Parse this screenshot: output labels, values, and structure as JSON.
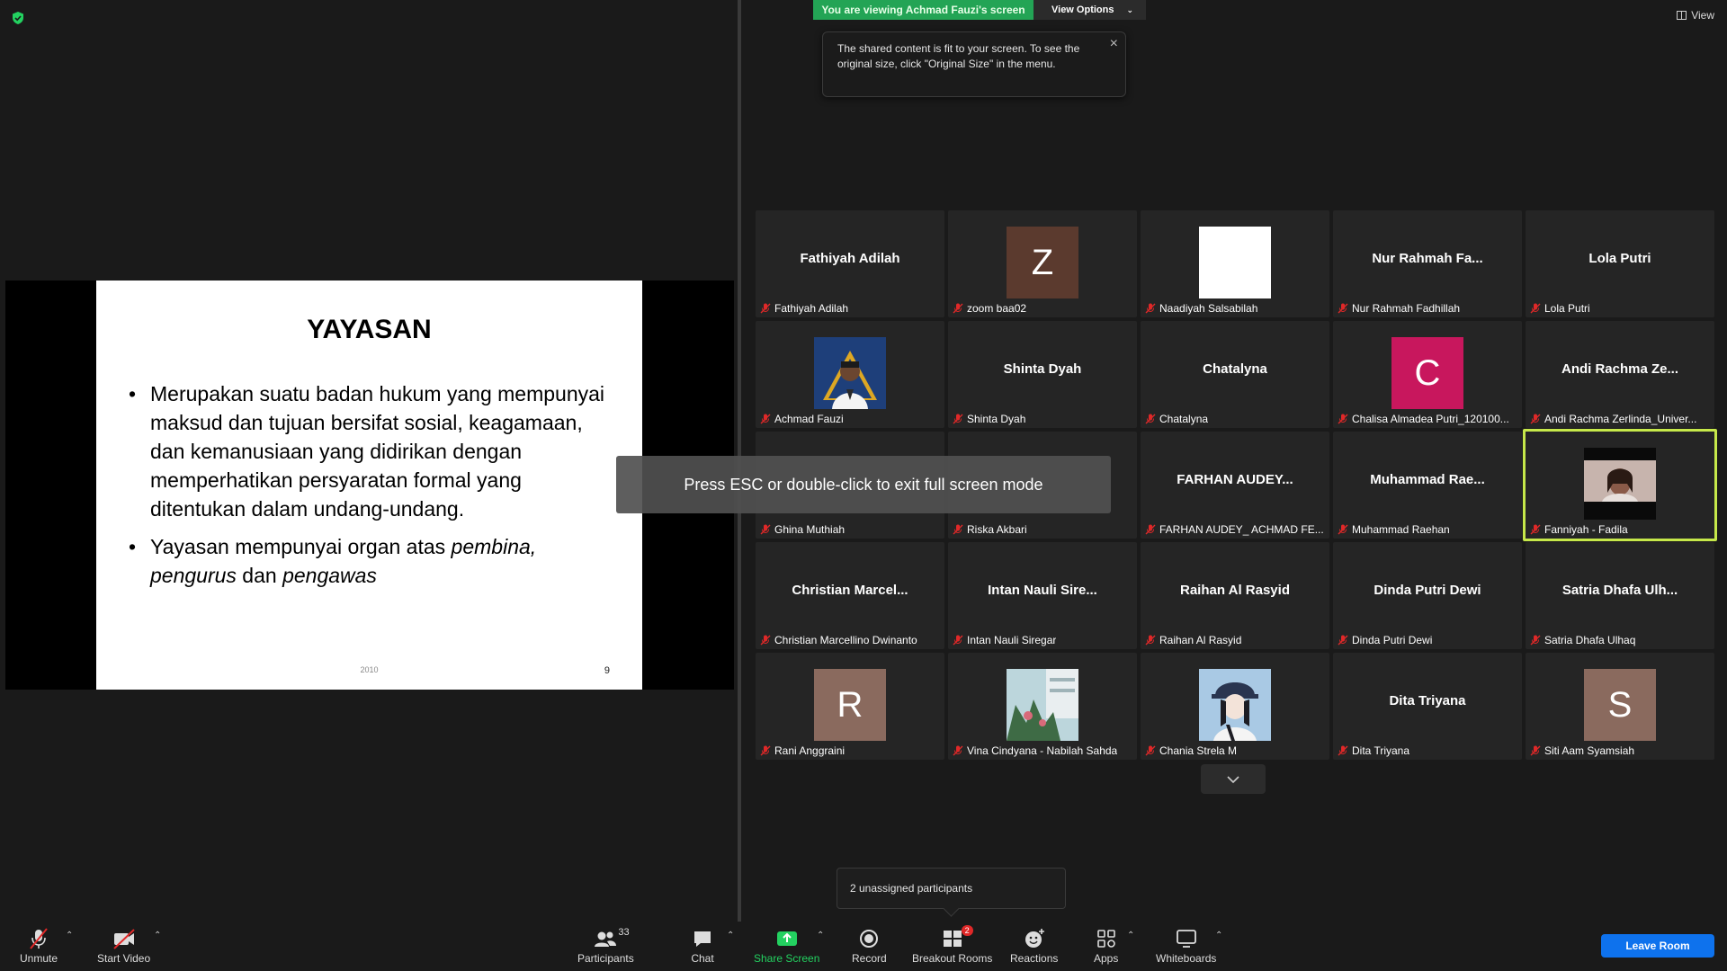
{
  "banner": {
    "viewing": "You are viewing Achmad Fauzi's screen",
    "view_options": "View Options"
  },
  "tooltip": {
    "text": "The shared content is fit to your screen. To see the original size, click \"Original Size\" in the menu."
  },
  "view_button": "View",
  "slide": {
    "title": "YAYASAN",
    "bullet1": "Merupakan suatu badan hukum yang mempunyai maksud dan tujuan bersifat sosial, keagamaan, dan kemanusiaan yang didirikan dengan memperhatikan persyaratan formal yang ditentukan dalam undang-undang.",
    "bullet2_pre": "Yayasan mempunyai organ atas ",
    "bullet2_em1": "pembina, pengurus",
    "bullet2_mid": " dan ",
    "bullet2_em2": "pengawas",
    "footer": "2010",
    "page_number": "9"
  },
  "fullscreen_toast": "Press ESC or double-click to exit full screen mode",
  "participants": {
    "row1": [
      {
        "display": "Fathiyah Adilah",
        "label": "Fathiyah Adilah"
      },
      {
        "letter": "Z",
        "color": "#5b3a2e",
        "label": "zoom baa02"
      },
      {
        "label": "Naadiyah Salsabilah"
      },
      {
        "display": "Nur Rahmah Fa...",
        "label": "Nur Rahmah Fadhillah"
      },
      {
        "display": "Lola Putri",
        "label": "Lola Putri"
      }
    ],
    "row2": [
      {
        "label": "Achmad Fauzi"
      },
      {
        "display": "Shinta Dyah",
        "label": "Shinta Dyah"
      },
      {
        "display": "Chatalyna",
        "label": "Chatalyna"
      },
      {
        "letter": "C",
        "color": "#c8175d",
        "label": "Chalisa Almadea Putri_120100..."
      },
      {
        "display": "Andi Rachma Ze...",
        "label": "Andi Rachma Zerlinda_Univer..."
      }
    ],
    "row3": [
      {
        "label": "Ghina Muthiah"
      },
      {
        "label": "Riska Akbari"
      },
      {
        "display": "FARHAN AUDEY...",
        "label": "FARHAN AUDEY_ ACHMAD FE..."
      },
      {
        "display": "Muhammad Rae...",
        "label": "Muhammad Raehan"
      },
      {
        "label": "Fanniyah - Fadila"
      }
    ],
    "row4": [
      {
        "display": "Christian Marcel...",
        "label": "Christian Marcellino Dwinanto"
      },
      {
        "display": "Intan Nauli Sire...",
        "label": "Intan Nauli Siregar"
      },
      {
        "display": "Raihan Al Rasyid",
        "label": "Raihan Al Rasyid"
      },
      {
        "display": "Dinda Putri Dewi",
        "label": "Dinda Putri Dewi"
      },
      {
        "display": "Satria Dhafa Ulh...",
        "label": "Satria Dhafa Ulhaq"
      }
    ],
    "row5": [
      {
        "letter": "R",
        "color": "#8a6a5e",
        "label": "Rani Anggraini"
      },
      {
        "label": "Vina Cindyana - Nabilah Sahda"
      },
      {
        "label": "Chania Strela M"
      },
      {
        "display": "Dita Triyana",
        "label": "Dita Triyana"
      },
      {
        "letter": "S",
        "color": "#8a6a5e",
        "label": "Siti Aam Syamsiah"
      }
    ]
  },
  "unassigned": "2 unassigned participants",
  "toolbar": {
    "unmute": "Unmute",
    "start_video": "Start Video",
    "participants": "Participants",
    "participants_count": "33",
    "chat": "Chat",
    "share_screen": "Share Screen",
    "record": "Record",
    "breakout_rooms": "Breakout Rooms",
    "breakout_badge": "2",
    "reactions": "Reactions",
    "apps": "Apps",
    "whiteboards": "Whiteboards",
    "leave": "Leave Room"
  }
}
